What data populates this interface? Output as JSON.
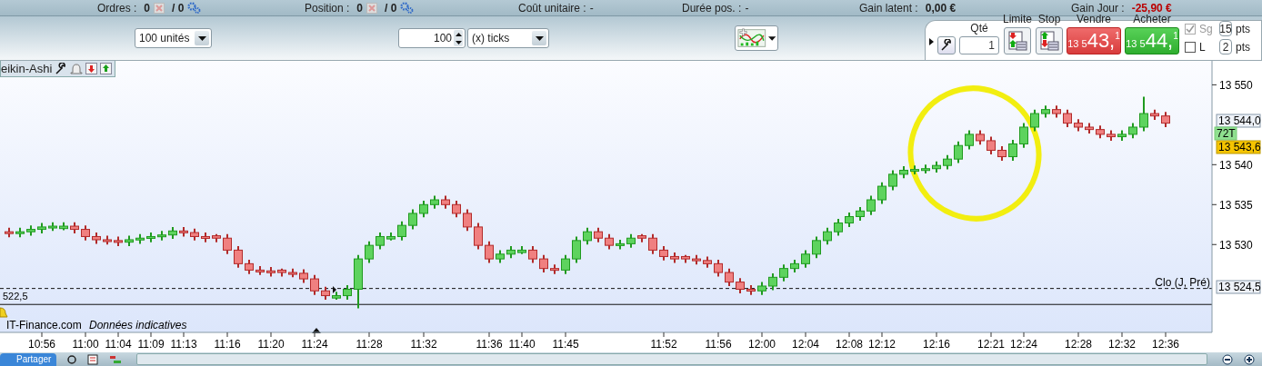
{
  "status_bar": [
    {
      "kind": "counter",
      "label": "Ordres :",
      "value": "0",
      "suffix": "/ 0"
    },
    {
      "kind": "counter",
      "label": "Position :",
      "value": "0",
      "suffix": "/ 0"
    },
    {
      "kind": "plain",
      "label": "Coût unitaire :",
      "value": "-"
    },
    {
      "kind": "plain",
      "label": "Durée pos. :",
      "value": "-"
    },
    {
      "kind": "amount",
      "label": "Gain latent :",
      "value": "0,00 €"
    },
    {
      "kind": "loss",
      "label": "Gain Jour :",
      "value": "-25,90 €"
    }
  ],
  "toolbar": {
    "quantity_select": "100 unités",
    "tick_count": "100",
    "tick_unit": "(x) ticks"
  },
  "order_panel": {
    "qty_label": "Qté",
    "qty": "1",
    "limit_label": "Limite",
    "stop_label": "Stop",
    "sell": {
      "label": "Vendre",
      "prefix": "13 5",
      "big": "43,",
      "frac": "1"
    },
    "buy": {
      "label": "Acheter",
      "prefix": "13 5",
      "big": "44,",
      "frac": "1"
    },
    "options": [
      {
        "label": "Sg",
        "checked": true,
        "disabled": true,
        "value": "15",
        "unit": "pts"
      },
      {
        "label": "L",
        "checked": false,
        "disabled": false,
        "value": "2",
        "unit": "pts"
      }
    ]
  },
  "chart": {
    "tab_label": "eikin-Ashi",
    "line_value_label": "522,5",
    "source": "IT-Finance.com",
    "note": "Données indicatives",
    "price_tags": [
      {
        "kind": "last",
        "text": "13 544,0"
      },
      {
        "kind": "ticks",
        "text": "72T"
      },
      {
        "kind": "current",
        "text": "13 543,6"
      },
      {
        "kind": "close",
        "text": "13 524,5"
      }
    ],
    "chart_data": {
      "type": "candlestick",
      "ylim": [
        13519,
        13553
      ],
      "yticks": [
        {
          "value": 13550,
          "label": "13 550"
        },
        {
          "value": 13540,
          "label": "13 540"
        },
        {
          "value": 13535,
          "label": "13 535"
        },
        {
          "value": 13530,
          "label": "13 530"
        }
      ],
      "ref_lines": [
        {
          "axis": "y",
          "value": 13524.5,
          "label": "Clo (J, Pré)"
        },
        {
          "axis": "y",
          "value": 13522.5
        }
      ],
      "categories": [
        null,
        null,
        null,
        "10:56",
        null,
        null,
        null,
        "11:00",
        null,
        null,
        "11:04",
        null,
        null,
        "11:09",
        null,
        null,
        "11:13",
        null,
        null,
        null,
        "11:16",
        null,
        null,
        null,
        "11:20",
        null,
        null,
        null,
        "11:24",
        null,
        null,
        null,
        null,
        "11:28",
        null,
        null,
        null,
        null,
        "11:32",
        null,
        null,
        null,
        null,
        null,
        "11:36",
        null,
        null,
        "11:40",
        null,
        null,
        null,
        "11:45",
        null,
        null,
        null,
        null,
        null,
        null,
        null,
        null,
        "11:52",
        null,
        null,
        null,
        null,
        "11:56",
        null,
        null,
        null,
        "12:00",
        null,
        null,
        null,
        "12:04",
        null,
        null,
        null,
        "12:08",
        null,
        null,
        "12:12",
        null,
        null,
        null,
        null,
        "12:16",
        null,
        null,
        null,
        null,
        "12:21",
        null,
        null,
        "12:24",
        null,
        null,
        null,
        null,
        "12:28",
        null,
        null,
        null,
        "12:32",
        null,
        null,
        null,
        "12:36"
      ],
      "ohlc": [
        [
          13531.6,
          13532.1,
          13530.9,
          13531.4
        ],
        [
          13531.4,
          13532.1,
          13530.9,
          13531.6
        ],
        [
          13531.6,
          13532.4,
          13531.1,
          13531.9
        ],
        [
          13531.9,
          13532.7,
          13531.4,
          13532.2
        ],
        [
          13532.2,
          13532.8,
          13531.7,
          13532.3
        ],
        [
          13532.0,
          13532.8,
          13531.8,
          13532.3
        ],
        [
          13532.3,
          13532.8,
          13531.4,
          13531.9
        ],
        [
          13531.9,
          13532.4,
          13530.5,
          13531.0
        ],
        [
          13531.0,
          13531.5,
          13530.1,
          13530.6
        ],
        [
          13530.6,
          13531.1,
          13530.0,
          13530.5
        ],
        [
          13530.5,
          13531.0,
          13529.8,
          13530.3
        ],
        [
          13530.3,
          13531.1,
          13529.8,
          13530.6
        ],
        [
          13530.6,
          13531.3,
          13530.1,
          13530.8
        ],
        [
          13530.8,
          13531.5,
          13530.3,
          13531.0
        ],
        [
          13531.0,
          13531.7,
          13530.5,
          13531.2
        ],
        [
          13531.2,
          13532.2,
          13530.7,
          13531.7
        ],
        [
          13531.7,
          13532.2,
          13531.0,
          13531.5
        ],
        [
          13531.5,
          13532.0,
          13530.5,
          13531.0
        ],
        [
          13531.0,
          13531.5,
          13530.3,
          13530.8
        ],
        [
          13531.1,
          13531.3,
          13530.3,
          13530.8
        ],
        [
          13530.8,
          13531.3,
          13528.8,
          13529.3
        ],
        [
          13529.3,
          13529.8,
          13527.1,
          13527.6
        ],
        [
          13527.6,
          13528.1,
          13526.3,
          13526.8
        ],
        [
          13526.8,
          13527.3,
          13526.2,
          13526.7
        ],
        [
          13526.7,
          13527.2,
          13526.0,
          13526.5
        ],
        [
          13526.8,
          13527.0,
          13526.0,
          13526.5
        ],
        [
          13526.5,
          13527.0,
          13525.9,
          13526.4
        ],
        [
          13526.4,
          13526.9,
          13525.2,
          13525.7
        ],
        [
          13525.7,
          13526.2,
          13523.7,
          13524.2
        ],
        [
          13524.2,
          13524.7,
          13523.1,
          13523.6
        ],
        [
          13523.3,
          13524.1,
          13523.1,
          13523.6
        ],
        [
          13523.6,
          13524.9,
          13523.1,
          13524.4
        ],
        [
          13524.4,
          13528.7,
          13522.0,
          13528.2
        ],
        [
          13528.2,
          13530.4,
          13527.7,
          13529.9
        ],
        [
          13529.9,
          13531.5,
          13529.4,
          13531.0
        ],
        [
          13530.7,
          13531.5,
          13530.5,
          13531.0
        ],
        [
          13531.0,
          13532.9,
          13530.5,
          13532.4
        ],
        [
          13532.4,
          13534.4,
          13531.9,
          13533.9
        ],
        [
          13533.9,
          13535.5,
          13533.4,
          13535.0
        ],
        [
          13535.0,
          13536.1,
          13534.5,
          13535.6
        ],
        [
          13535.6,
          13536.1,
          13534.5,
          13535.0
        ],
        [
          13535.0,
          13535.5,
          13533.4,
          13533.9
        ],
        [
          13533.9,
          13534.4,
          13531.7,
          13532.2
        ],
        [
          13532.2,
          13532.7,
          13529.4,
          13529.9
        ],
        [
          13529.9,
          13530.4,
          13527.7,
          13528.2
        ],
        [
          13528.2,
          13529.3,
          13527.7,
          13528.8
        ],
        [
          13528.8,
          13529.8,
          13528.3,
          13529.3
        ],
        [
          13529.0,
          13529.8,
          13528.8,
          13529.3
        ],
        [
          13529.3,
          13529.8,
          13527.7,
          13528.2
        ],
        [
          13528.2,
          13528.7,
          13526.5,
          13527.0
        ],
        [
          13527.0,
          13527.5,
          13526.3,
          13526.8
        ],
        [
          13526.8,
          13528.7,
          13526.3,
          13528.2
        ],
        [
          13528.2,
          13531.0,
          13527.7,
          13530.5
        ],
        [
          13530.5,
          13532.1,
          13530.0,
          13531.6
        ],
        [
          13531.6,
          13532.1,
          13530.3,
          13530.8
        ],
        [
          13530.8,
          13531.3,
          13529.4,
          13529.9
        ],
        [
          13529.9,
          13530.6,
          13529.4,
          13530.1
        ],
        [
          13530.1,
          13531.3,
          13529.6,
          13530.8
        ],
        [
          13531.1,
          13531.3,
          13530.3,
          13530.8
        ],
        [
          13530.8,
          13531.3,
          13528.8,
          13529.3
        ],
        [
          13529.3,
          13529.8,
          13528.0,
          13528.5
        ],
        [
          13528.5,
          13529.0,
          13527.7,
          13528.2
        ],
        [
          13528.5,
          13528.7,
          13527.7,
          13528.2
        ],
        [
          13528.2,
          13528.7,
          13527.5,
          13528.0
        ],
        [
          13528.0,
          13528.5,
          13527.1,
          13527.6
        ],
        [
          13527.6,
          13528.1,
          13526.0,
          13526.5
        ],
        [
          13526.5,
          13527.0,
          13524.8,
          13525.3
        ],
        [
          13525.3,
          13525.8,
          13523.9,
          13524.4
        ],
        [
          13524.4,
          13524.9,
          13523.7,
          13524.2
        ],
        [
          13524.2,
          13525.3,
          13523.7,
          13524.8
        ],
        [
          13524.8,
          13526.4,
          13524.3,
          13525.9
        ],
        [
          13525.9,
          13527.5,
          13525.4,
          13527.0
        ],
        [
          13527.0,
          13528.1,
          13526.5,
          13527.6
        ],
        [
          13527.6,
          13529.3,
          13527.1,
          13528.8
        ],
        [
          13528.8,
          13531.0,
          13528.3,
          13530.5
        ],
        [
          13530.5,
          13532.1,
          13530.0,
          13531.6
        ],
        [
          13531.6,
          13533.2,
          13531.1,
          13532.7
        ],
        [
          13532.7,
          13534.0,
          13532.2,
          13533.5
        ],
        [
          13533.5,
          13534.7,
          13533.0,
          13534.2
        ],
        [
          13534.2,
          13536.1,
          13533.7,
          13535.6
        ],
        [
          13535.6,
          13537.8,
          13535.1,
          13537.3
        ],
        [
          13537.3,
          13539.3,
          13536.8,
          13538.8
        ],
        [
          13538.8,
          13539.8,
          13538.3,
          13539.3
        ],
        [
          13539.3,
          13539.9,
          13538.8,
          13539.4
        ],
        [
          13539.4,
          13540.0,
          13538.9,
          13539.5
        ],
        [
          13539.5,
          13540.4,
          13539.0,
          13539.9
        ],
        [
          13539.9,
          13541.2,
          13539.4,
          13540.7
        ],
        [
          13540.7,
          13542.9,
          13540.2,
          13542.4
        ],
        [
          13542.4,
          13544.3,
          13541.9,
          13543.8
        ],
        [
          13543.8,
          13544.3,
          13542.5,
          13543.0
        ],
        [
          13543.0,
          13543.5,
          13541.3,
          13541.8
        ],
        [
          13541.8,
          13542.3,
          13540.5,
          13541.0
        ],
        [
          13541.0,
          13543.1,
          13540.5,
          13542.6
        ],
        [
          13542.6,
          13545.2,
          13542.1,
          13544.7
        ],
        [
          13544.7,
          13546.9,
          13544.2,
          13546.4
        ],
        [
          13546.4,
          13547.4,
          13545.9,
          13546.9
        ],
        [
          13546.9,
          13547.4,
          13545.9,
          13546.4
        ],
        [
          13546.4,
          13546.9,
          13544.7,
          13545.2
        ],
        [
          13545.2,
          13545.7,
          13544.2,
          13544.7
        ],
        [
          13544.7,
          13545.2,
          13543.9,
          13544.4
        ],
        [
          13544.4,
          13544.9,
          13543.3,
          13543.8
        ],
        [
          13543.8,
          13544.3,
          13543.0,
          13543.5
        ],
        [
          13543.5,
          13544.3,
          13543.0,
          13543.8
        ],
        [
          13543.8,
          13545.2,
          13543.3,
          13544.7
        ],
        [
          13544.7,
          13548.5,
          13544.2,
          13546.4
        ],
        [
          13546.4,
          13546.9,
          13545.6,
          13546.1
        ],
        [
          13546.1,
          13546.6,
          13544.7,
          13545.2
        ]
      ]
    }
  },
  "bottom_bar": {
    "share_button": "Partager"
  }
}
